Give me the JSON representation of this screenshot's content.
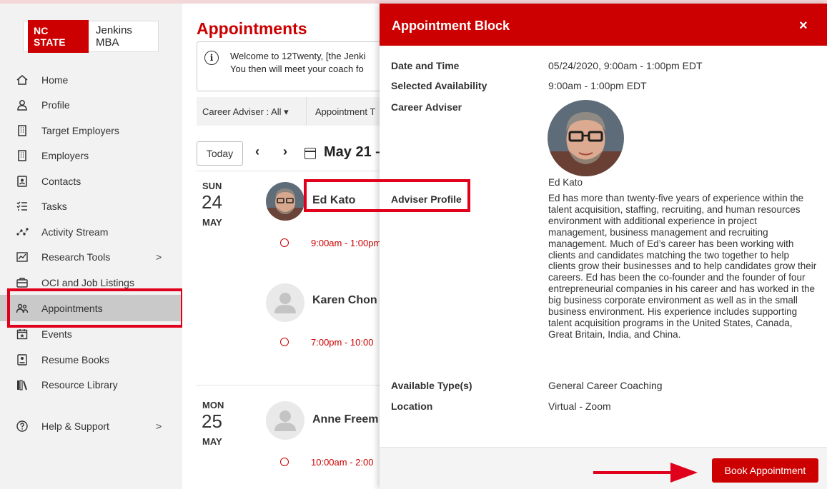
{
  "brand": {
    "badge": "NC STATE",
    "program": "Jenkins MBA"
  },
  "sidebar": {
    "items": [
      {
        "label": "Home",
        "icon": "home-icon"
      },
      {
        "label": "Profile",
        "icon": "user-icon"
      },
      {
        "label": "Target Employers",
        "icon": "building-icon"
      },
      {
        "label": "Employers",
        "icon": "building-icon"
      },
      {
        "label": "Contacts",
        "icon": "contact-card-icon"
      },
      {
        "label": "Tasks",
        "icon": "checklist-icon"
      },
      {
        "label": "Activity Stream",
        "icon": "activity-icon"
      },
      {
        "label": "Research Tools",
        "icon": "chart-icon",
        "chevron": ">"
      },
      {
        "label": "OCI and Job Listings",
        "icon": "briefcase-icon"
      },
      {
        "label": "Appointments",
        "icon": "people-icon",
        "active": true
      },
      {
        "label": "Events",
        "icon": "calendar-star-icon"
      },
      {
        "label": "Resume Books",
        "icon": "resume-icon"
      },
      {
        "label": "Resource Library",
        "icon": "library-icon"
      },
      {
        "label": "Help & Support",
        "icon": "help-icon",
        "chevron": ">"
      }
    ]
  },
  "main": {
    "title": "Appointments",
    "welcome": {
      "line1": "Welcome to 12Twenty, [the Jenki",
      "line2": "You then will meet your coach fo"
    },
    "filters": {
      "career_adviser": "Career Adviser : All ▾",
      "appointment_type": "Appointment T"
    },
    "calendar": {
      "today": "Today",
      "prev": "‹",
      "next": "›",
      "range": "May 21 –"
    },
    "days": [
      {
        "dow": "SUN",
        "num": "24",
        "mon": "MAY",
        "coaches": [
          {
            "name": "Ed Kato",
            "time": "9:00am - 1:00pm"
          },
          {
            "name": "Karen Chon",
            "time": "7:00pm - 10:00"
          }
        ]
      },
      {
        "dow": "MON",
        "num": "25",
        "mon": "MAY",
        "coaches": [
          {
            "name": "Anne Freem",
            "time": "10:00am - 2:00"
          }
        ]
      }
    ]
  },
  "panel": {
    "title": "Appointment Block",
    "close": "×",
    "fields": {
      "date_label": "Date and Time",
      "date_value": "05/24/2020, 9:00am - 1:00pm EDT",
      "avail_label": "Selected Availability",
      "avail_value": "9:00am - 1:00pm EDT",
      "adviser_label": "Career Adviser",
      "adviser_name": "Ed Kato",
      "profile_label": "Adviser Profile",
      "profile_text": "Ed has more than twenty-five years of experience within the talent acquisition, staffing, recruiting, and human resources environment with additional experience in project management, business management and recruiting management. Much of Ed’s career has been working with clients and candidates matching the two together to help clients grow their businesses and to help candidates grow their careers. Ed has been the co-founder and the founder of four entrepreneurial companies in his career and has worked in the big business corporate environment as well as in the small business environment. His experience includes supporting talent acquisition programs in the United States, Canada, Great Britain, India, and China.",
      "types_label": "Available Type(s)",
      "types_value": "General Career Coaching",
      "location_label": "Location",
      "location_value": "Virtual - Zoom"
    },
    "book_button": "Book Appointment"
  },
  "colors": {
    "accent": "#cc0000",
    "highlight": "#e0001b",
    "sidebar_bg": "#f2f2f2",
    "active_bg": "#c9c9c9"
  }
}
